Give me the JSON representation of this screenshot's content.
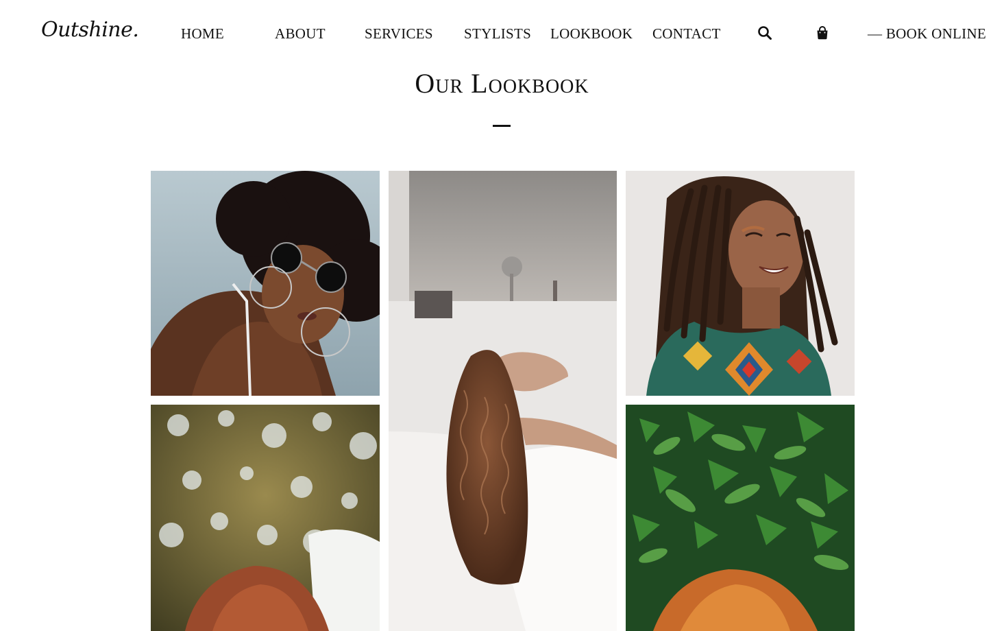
{
  "header": {
    "logo": "Outshine.",
    "nav": [
      {
        "label": "HOME"
      },
      {
        "label": "ABOUT"
      },
      {
        "label": "SERVICES"
      },
      {
        "label": "STYLISTS"
      },
      {
        "label": "LOOKBOOK"
      },
      {
        "label": "CONTACT"
      }
    ],
    "search_icon": "search-icon",
    "cart_icon": "shopping-bag-icon",
    "book_label": "— BOOK ONLINE"
  },
  "page": {
    "title": "Our Lookbook"
  },
  "gallery": {
    "items": [
      {
        "name": "lookbook-photo-curly-afro-sunglasses"
      },
      {
        "name": "lookbook-photo-curly-hair-bathtub"
      },
      {
        "name": "lookbook-photo-box-braids-smile"
      },
      {
        "name": "lookbook-photo-auburn-hair-bokeh"
      },
      {
        "name": "lookbook-photo-copper-hair-leaves"
      }
    ]
  },
  "colors": {
    "text": "#111111",
    "background": "#ffffff"
  }
}
